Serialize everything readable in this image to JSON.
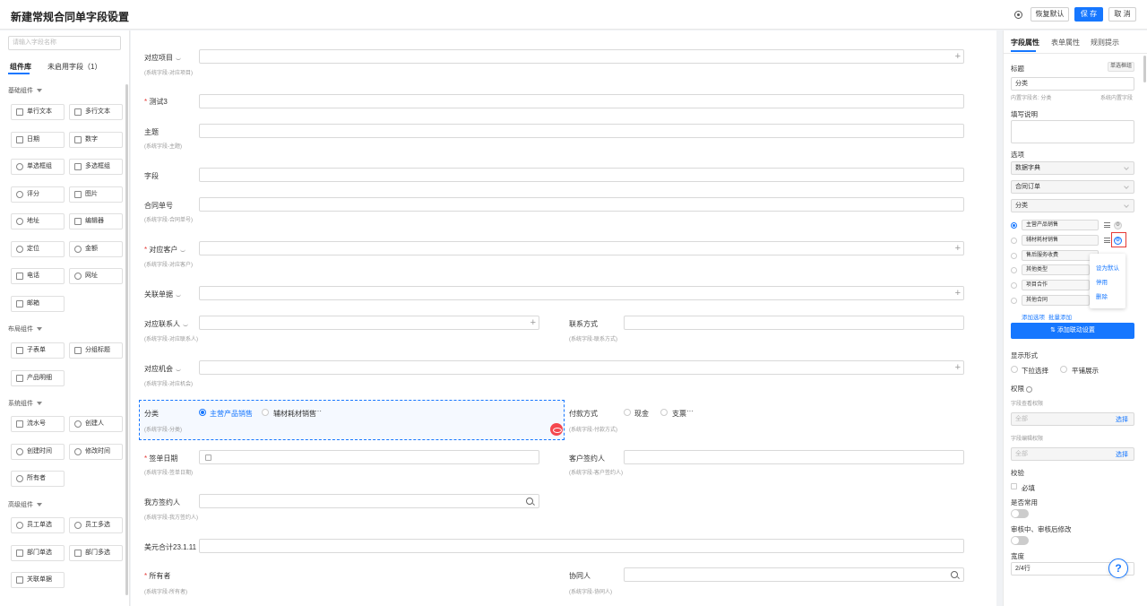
{
  "header": {
    "title": "新建常规合同单字段设置",
    "restore_label": "恢复默认",
    "save_label": "保 存",
    "cancel_label": "取 消"
  },
  "left": {
    "search_placeholder": "请输入字段名称",
    "tabs": [
      "组件库",
      "未启用字段（1）"
    ],
    "groups": [
      {
        "title": "基础组件",
        "items": [
          "单行文本",
          "多行文本",
          "日期",
          "数字",
          "单选框组",
          "多选框组",
          "评分",
          "图片",
          "地址",
          "编辑器",
          "定位",
          "金额",
          "电话",
          "网址",
          "邮箱"
        ]
      },
      {
        "title": "布局组件",
        "items": [
          "子表单",
          "分组标题",
          "产品明细"
        ]
      },
      {
        "title": "系统组件",
        "items": [
          "流水号",
          "创建人",
          "创建时间",
          "修改时间",
          "所有者"
        ]
      },
      {
        "title": "高级组件",
        "items": [
          "员工单选",
          "员工多选",
          "部门单选",
          "部门多选",
          "关联单据"
        ]
      }
    ]
  },
  "canvas": {
    "fields": {
      "project": {
        "label": "对应项目",
        "sub": "(系统字段-对应项目)"
      },
      "test3": {
        "label": "测试3"
      },
      "subject": {
        "label": "主题",
        "sub": "(系统字段-主题)"
      },
      "field": {
        "label": "字段"
      },
      "contract_no": {
        "label": "合同单号",
        "sub": "(系统字段-合同单号)"
      },
      "customer": {
        "label": "对应客户",
        "sub": "(系统字段-对应客户)"
      },
      "related_doc": {
        "label": "关联单据"
      },
      "contact": {
        "label": "对应联系人",
        "sub": "(系统字段-对应联系人)"
      },
      "contact_method": {
        "label": "联系方式",
        "sub": "(系统字段-联系方式)"
      },
      "opportunity": {
        "label": "对应机会",
        "sub": "(系统字段-对应机会)"
      },
      "category": {
        "label": "分类",
        "sub": "(系统字段-分类)",
        "opt1": "主营产品销售",
        "opt2": "辅材耗材销售",
        "more": "···"
      },
      "payment": {
        "label": "付款方式",
        "sub": "(系统字段-付款方式)",
        "opt1": "现金",
        "opt2": "支票",
        "more": "···"
      },
      "sign_date": {
        "label": "签单日期",
        "sub": "(系统字段-签单日期)"
      },
      "cust_signer": {
        "label": "客户签约人",
        "sub": "(系统字段-客户签约人)"
      },
      "our_signer": {
        "label": "我方签约人",
        "sub": "(系统字段-我方签约人)"
      },
      "usd_total": {
        "label": "美元合计23.1.11"
      },
      "owner": {
        "label": "所有者",
        "sub": "(系统字段-所有者)"
      },
      "collaborator": {
        "label": "协同人",
        "sub": "(系统字段-协同人)"
      }
    }
  },
  "right": {
    "tabs": [
      "字段属性",
      "表单属性",
      "规则提示"
    ],
    "title_label": "标题",
    "type_tag": "单选框组",
    "title_value": "分类",
    "inner_name": "内置字段名: 分类",
    "system_builtin": "系统内置字段",
    "desc_label": "填写说明",
    "options_label": "选项",
    "source": "数据字典",
    "dict": "合同订单",
    "category": "分类",
    "options": [
      "主营产品销售",
      "辅材耗材销售",
      "售后服务收费",
      "其他类型",
      "项目合作",
      "其他合同"
    ],
    "popup": [
      "设为默认",
      "停用",
      "删除"
    ],
    "add_option": "添加选项",
    "batch_add": "批量添加",
    "linkage_btn": "⇅ 添加联动设置",
    "display_label": "显示形式",
    "display_opt1": "下拉选择",
    "display_opt2": "平铺展示",
    "perm_label": "权限",
    "view_perm": "字段查看权限",
    "view_value": "全部",
    "edit_perm": "字段编辑权限",
    "edit_value": "全部",
    "select_label": "选择",
    "verify_label": "校验",
    "required_label": "必填",
    "common_label": "是否常用",
    "review_label": "审核中、审核后修改",
    "width_label": "宽度",
    "width_value": "2/4行"
  },
  "help_label": "?"
}
